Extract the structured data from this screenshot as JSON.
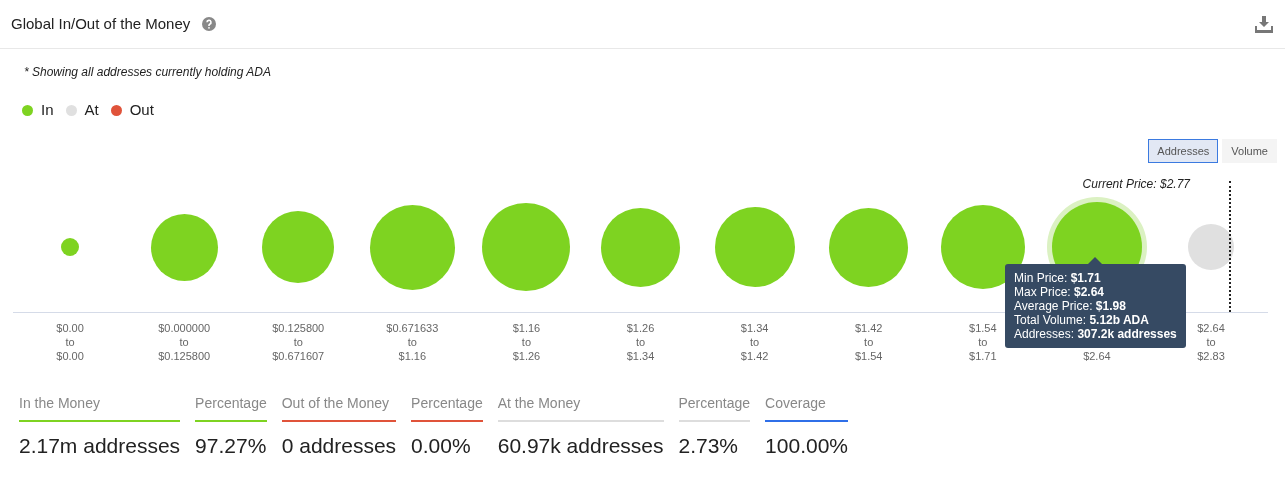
{
  "header": {
    "title": "Global In/Out of the Money"
  },
  "note": "* Showing all addresses currently holding ADA",
  "legend": [
    {
      "label": "In",
      "color": "#7ed321"
    },
    {
      "label": "At",
      "color": "#e0e0e0"
    },
    {
      "label": "Out",
      "color": "#e0533a"
    }
  ],
  "toggle": [
    {
      "label": "Addresses",
      "selected": true
    },
    {
      "label": "Volume",
      "selected": false
    }
  ],
  "current_price": "Current Price: $2.77",
  "buckets": [
    {
      "lines": [
        "$0.00",
        "to",
        "$0.00"
      ],
      "color": "#7ed321",
      "selected": false
    },
    {
      "lines": [
        "$0.000000",
        "to",
        "$0.125800"
      ],
      "color": "#7ed321",
      "selected": false
    },
    {
      "lines": [
        "$0.125800",
        "to",
        "$0.671607"
      ],
      "color": "#7ed321",
      "selected": false
    },
    {
      "lines": [
        "$0.671633",
        "to",
        "$1.16"
      ],
      "color": "#7ed321",
      "selected": false
    },
    {
      "lines": [
        "$1.16",
        "to",
        "$1.26"
      ],
      "color": "#7ed321",
      "selected": false
    },
    {
      "lines": [
        "$1.26",
        "to",
        "$1.34"
      ],
      "color": "#7ed321",
      "selected": false
    },
    {
      "lines": [
        "$1.34",
        "to",
        "$1.42"
      ],
      "color": "#7ed321",
      "selected": false
    },
    {
      "lines": [
        "$1.42",
        "to",
        "$1.54"
      ],
      "color": "#7ed321",
      "selected": false
    },
    {
      "lines": [
        "$1.54",
        "to",
        "$1.71"
      ],
      "color": "#7ed321",
      "selected": false
    },
    {
      "lines": [
        "$2.64"
      ],
      "color": "#7ed321",
      "selected": true
    },
    {
      "lines": [
        "$2.64",
        "to",
        "$2.83"
      ],
      "color": "#e0e0e0",
      "selected": false
    }
  ],
  "tooltip": [
    "Min Price: **$1.71**",
    "Max Price: **$2.64**",
    "Average Price: **$1.98**",
    "Total Volume: **5.12b ADA**",
    "Addresses: **307.2k addresses**"
  ],
  "stats": [
    {
      "label": "In the Money",
      "value": "2.17m addresses",
      "color": "#7ed321"
    },
    {
      "label": "Percentage",
      "value": "97.27%",
      "color": "#7ed321"
    },
    {
      "label": "Out of the Money",
      "value": "0 addresses",
      "color": "#e0533a"
    },
    {
      "label": "Percentage",
      "value": "0.00%",
      "color": "#e0533a"
    },
    {
      "label": "At the Money",
      "value": "60.97k addresses",
      "color": "#dddddd"
    },
    {
      "label": "Percentage",
      "value": "2.73%",
      "color": "#dddddd"
    },
    {
      "label": "Coverage",
      "value": "100.00%",
      "color": "#2f6fe8"
    }
  ]
}
